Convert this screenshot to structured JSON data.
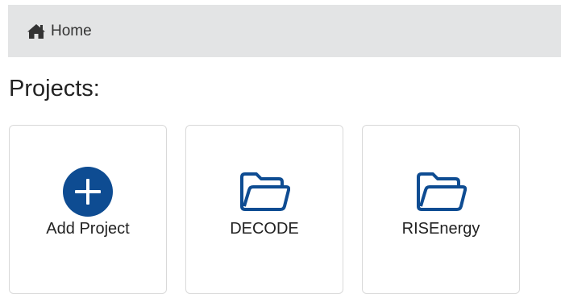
{
  "breadcrumb": {
    "home_label": "Home",
    "home_icon": "home-icon"
  },
  "page_title": "Projects:",
  "tiles": [
    {
      "label": "Add Project",
      "icon": "plus-circle-icon"
    },
    {
      "label": "DECODE",
      "icon": "folder-icon"
    },
    {
      "label": "RISEnergy",
      "icon": "folder-icon"
    }
  ],
  "colors": {
    "accent": "#0e4c92",
    "breadcrumb_bg": "#e3e4e5",
    "tile_border": "#d9d9d9"
  }
}
